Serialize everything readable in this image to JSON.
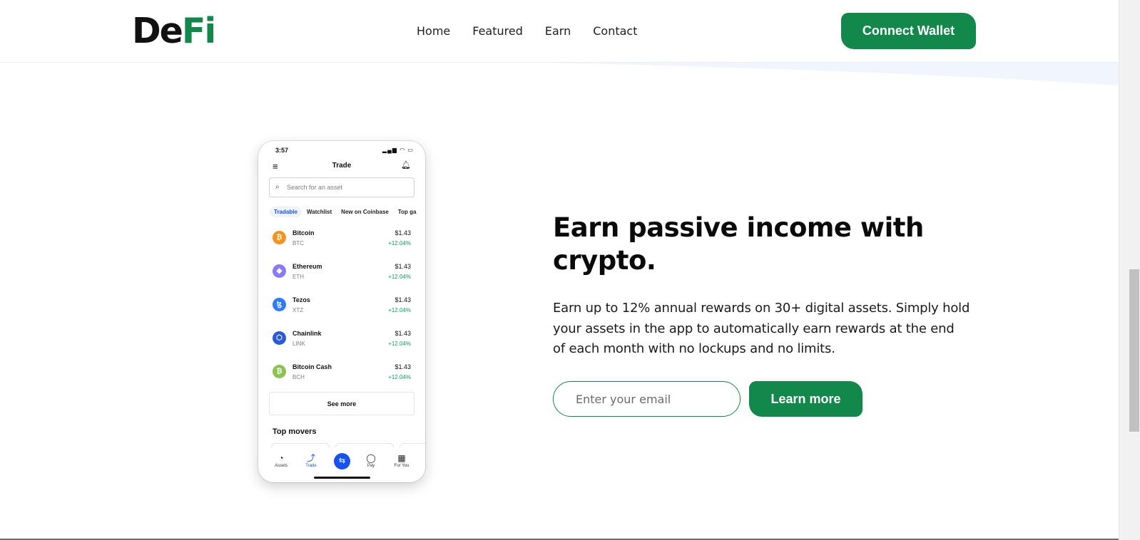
{
  "brand": {
    "logo_part1": "De",
    "logo_part2": "Fi",
    "accent_color": "#13884b"
  },
  "nav": {
    "items": [
      "Home",
      "Featured",
      "Earn",
      "Contact"
    ]
  },
  "header": {
    "connect_label": "Connect Wallet"
  },
  "phone": {
    "time": "3:57",
    "status_icons": "signal-wifi-battery",
    "title": "Trade",
    "search_placeholder": "Search for an asset",
    "tabs": [
      "Tradable",
      "Watchlist",
      "New on Coinbase",
      "Top ga"
    ],
    "active_tab": "Tradable",
    "assets": [
      {
        "name": "Bitcoin",
        "symbol": "BTC",
        "price": "$1.43",
        "change": "+12.04%",
        "icon_color": "#f7931a",
        "glyph": "₿"
      },
      {
        "name": "Ethereum",
        "symbol": "ETH",
        "price": "$1.43",
        "change": "+12.04%",
        "icon_color": "#8a7cf5",
        "glyph": "◆"
      },
      {
        "name": "Tezos",
        "symbol": "XTZ",
        "price": "$1.43",
        "change": "+12.04%",
        "icon_color": "#2c7df7",
        "glyph": "ꜩ"
      },
      {
        "name": "Chainlink",
        "symbol": "LINK",
        "price": "$1.43",
        "change": "+12.04%",
        "icon_color": "#2a5ada",
        "glyph": "⬡"
      },
      {
        "name": "Bitcoin Cash",
        "symbol": "BCH",
        "price": "$1.43",
        "change": "+12.04%",
        "icon_color": "#8dc351",
        "glyph": "₿"
      }
    ],
    "see_more": "See more",
    "top_movers": "Top movers",
    "bottom_nav": [
      {
        "label": "Assets",
        "glyph": "◔"
      },
      {
        "label": "Trade",
        "glyph": "⤴"
      },
      {
        "label": "",
        "glyph": "⇆"
      },
      {
        "label": "Pay",
        "glyph": "◯"
      },
      {
        "label": "For You",
        "glyph": "▦"
      }
    ]
  },
  "hero": {
    "title": "Earn passive income with crypto.",
    "description": "Earn up to 12% annual rewards on 30+ digital assets. Simply hold your assets in the app to automatically earn rewards at the end of each month with no lockups and no limits.",
    "email_placeholder": "Enter your email",
    "cta_label": "Learn more"
  }
}
